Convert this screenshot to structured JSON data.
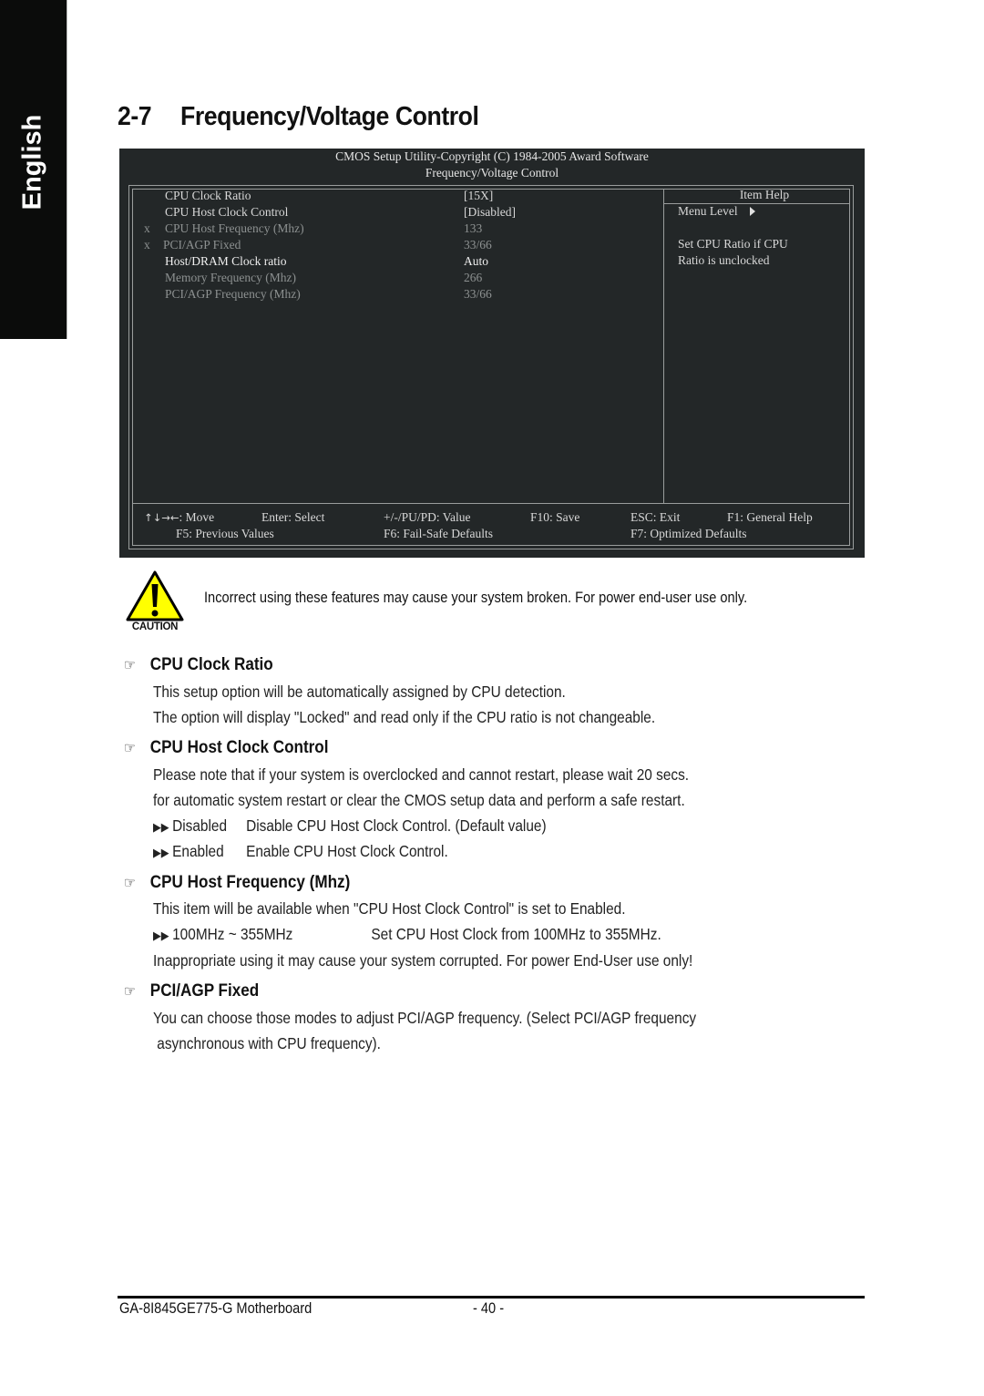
{
  "side_tab": {
    "label": "English"
  },
  "section": {
    "number": "2-7",
    "title": "Frequency/Voltage Control"
  },
  "bios": {
    "header_line1": "CMOS Setup Utility-Copyright (C) 1984-2005 Award Software",
    "header_line2": "Frequency/Voltage Control",
    "items": [
      {
        "marker": "",
        "label": "CPU Clock Ratio",
        "value": "[15X]",
        "state": "active"
      },
      {
        "marker": "",
        "label": "CPU Host Clock Control",
        "value": "[Disabled]",
        "state": "active"
      },
      {
        "marker": "x",
        "label": "CPU Host Frequency (Mhz)",
        "value": "133",
        "state": "disabled"
      },
      {
        "marker": "x",
        "label": "PCI/AGP Fixed",
        "value": "33/66",
        "state": "disabled"
      },
      {
        "marker": "",
        "label": "Host/DRAM Clock ratio",
        "value": "Auto",
        "state": "active"
      },
      {
        "marker": "",
        "label": "Memory Frequency (Mhz)",
        "value": "266",
        "state": "disabled"
      },
      {
        "marker": "",
        "label": "PCI/AGP Frequency (Mhz)",
        "value": "33/66",
        "state": "disabled"
      }
    ],
    "help": {
      "title": "Item Help",
      "menu_level": "Menu Level",
      "menu_level_icon": "triangle-right-icon",
      "lines": [
        "Set CPU Ratio if CPU",
        "Ratio is unclocked"
      ]
    },
    "footer": {
      "row1": [
        {
          "key": "↑↓→←",
          "text": ": Move"
        },
        {
          "key": "Enter",
          "text": ": Select"
        },
        {
          "key": "+/-/PU/PD",
          "text": ": Value"
        },
        {
          "key": "F10",
          "text": ": Save"
        },
        {
          "key": "ESC",
          "text": ": Exit"
        },
        {
          "key": "F1",
          "text": ": General Help"
        }
      ],
      "row2": [
        {
          "key": "F5",
          "text": ": Previous Values"
        },
        {
          "key": "F6",
          "text": ": Fail-Safe Defaults"
        },
        {
          "key": "F7",
          "text": ": Optimized Defaults"
        }
      ]
    },
    "colors": {
      "background": "#232728",
      "text": "#d8d8d8",
      "dim_text": "#8d9191",
      "border": "#9a9d9d"
    }
  },
  "caution": {
    "icon": "caution-warning-icon",
    "icon_label": "CAUTION",
    "text": "Incorrect using these features may cause your system broken. For power end-user use only.",
    "icon_color": "#ffff00"
  },
  "descriptions": [
    {
      "heading": "CPU Clock Ratio",
      "paragraphs": [
        "This setup option will be automatically assigned by CPU detection.",
        "The option will display \"Locked\" and read only if the CPU ratio is not changeable."
      ]
    },
    {
      "heading": "CPU Host Clock Control",
      "paragraphs": [
        "Please note that if your system is overclocked and cannot restart, please wait 20 secs.",
        "for automatic system restart or clear the CMOS setup data and perform a safe restart."
      ],
      "options": [
        {
          "name": "Disabled",
          "desc": "Disable CPU Host Clock Control. (Default value)"
        },
        {
          "name": "Enabled",
          "desc": "Enable CPU Host Clock Control."
        }
      ]
    },
    {
      "heading": "CPU Host Frequency (Mhz)",
      "paragraphs": [
        "This item will be available when \"CPU Host Clock Control\" is set to Enabled."
      ],
      "options": [
        {
          "name": "100MHz ~ 355MHz",
          "desc": "Set CPU Host Clock from 100MHz to 355MHz."
        }
      ],
      "note": "Inappropriate using it may cause your system corrupted. For power End-User use only!"
    },
    {
      "heading": "PCI/AGP Fixed",
      "paragraphs": [
        "You can choose those modes to adjust PCI/AGP frequency. (Select PCI/AGP frequency",
        " asynchronous with CPU frequency)."
      ]
    }
  ],
  "icons": {
    "bullet": "double-arrow-right-icon",
    "heading": "pointing-hand-icon"
  },
  "footer": {
    "model": "GA-8I845GE775-G Motherboard",
    "page": "- 40 -"
  }
}
